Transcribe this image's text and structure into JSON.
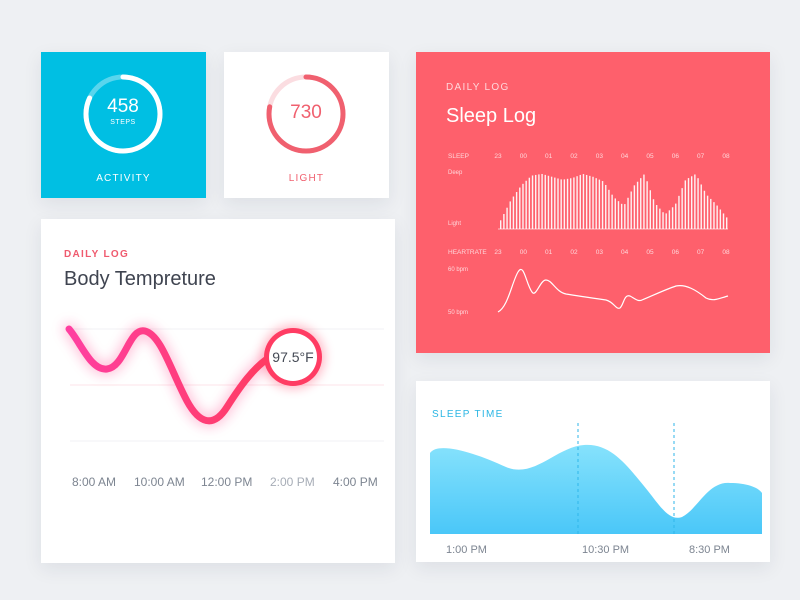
{
  "colors": {
    "activity_bg": "#00bfe3",
    "sleep_log_bg": "#fe606c",
    "temp_line_start": "#ff3f9a",
    "temp_line_end": "#ff3c63",
    "sleep_time_fill": "#5cd0f8",
    "accent_red": "#ef5a6e",
    "accent_blue": "#2bb6e4"
  },
  "activity": {
    "value": "458",
    "unit": "STEPS",
    "label": "ACTIVITY",
    "progress": 0.82
  },
  "light": {
    "value": "730",
    "label": "LIGHT",
    "progress": 0.78
  },
  "body_temp": {
    "eyebrow": "DAILY LOG",
    "title": "Body Tempreture",
    "marker_label": "97.5°F",
    "ticks": [
      "8:00 AM",
      "10:00 AM",
      "12:00 PM",
      "2:00 PM",
      "4:00 PM"
    ]
  },
  "sleep_log": {
    "eyebrow": "DAILY LOG",
    "title": "Sleep Log",
    "sleep_row_label": "SLEEP",
    "heartrate_row_label": "HEARTRATE",
    "hours": [
      "23",
      "00",
      "01",
      "02",
      "03",
      "04",
      "05",
      "06",
      "07",
      "08"
    ],
    "sleep_levels": [
      "Deep",
      "Light"
    ],
    "heartrate_levels": [
      "60 bpm",
      "50 bpm"
    ]
  },
  "sleep_time": {
    "eyebrow": "SLEEP TIME",
    "ticks": [
      "1:00 PM",
      "10:30 PM",
      "8:30 PM"
    ]
  },
  "chart_data": [
    {
      "type": "line",
      "title": "Body Tempreture",
      "x": [
        "8:00 AM",
        "10:00 AM",
        "12:00 PM",
        "2:00 PM",
        "4:00 PM"
      ],
      "highlight": {
        "label": "97.5°F",
        "x": "2:00 PM"
      }
    },
    {
      "type": "bar",
      "title": "Sleep Log",
      "categories": [
        "23",
        "00",
        "01",
        "02",
        "03",
        "04",
        "05",
        "06",
        "07",
        "08"
      ],
      "y_levels": [
        "Deep",
        "Light"
      ],
      "series": [
        {
          "name": "SLEEP",
          "values": [
            0.15,
            0.5,
            0.75,
            0.92,
            0.95,
            0.9,
            0.85,
            0.88,
            0.95,
            0.9,
            0.82,
            0.55,
            0.4,
            0.75,
            0.95,
            0.45,
            0.25,
            0.42,
            0.85,
            0.95,
            0.6,
            0.42,
            0.2
          ]
        }
      ]
    },
    {
      "type": "line",
      "title": "HEARTRATE",
      "categories": [
        "23",
        "00",
        "01",
        "02",
        "03",
        "04",
        "05",
        "06",
        "07",
        "08"
      ],
      "y_levels": [
        "60 bpm",
        "50 bpm"
      ]
    },
    {
      "type": "area",
      "title": "SLEEP TIME",
      "x": [
        "1:00 PM",
        "10:30 PM",
        "8:30 PM"
      ]
    }
  ]
}
